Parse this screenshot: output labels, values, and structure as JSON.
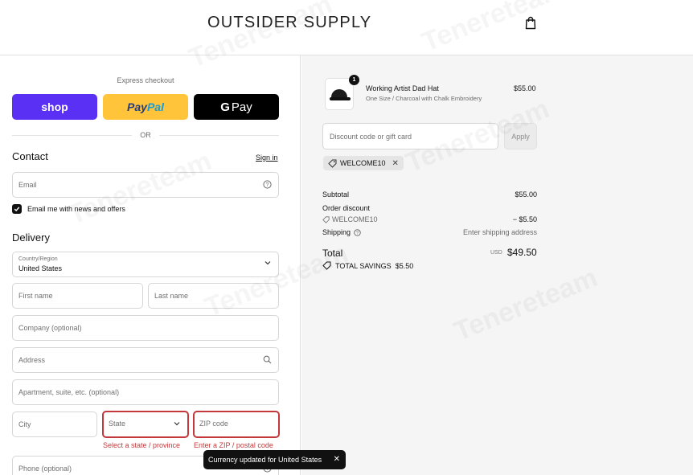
{
  "header": {
    "brand": "OUTSIDER SUPPLY",
    "cart_icon": "shopping-bag-icon"
  },
  "express": {
    "title": "Express checkout",
    "shop_label": "shop",
    "paypal_label_1": "Pay",
    "paypal_label_2": "Pal",
    "gpay_g": "G",
    "gpay_label": "Pay",
    "or_label": "OR"
  },
  "contact": {
    "heading": "Contact",
    "sign_in": "Sign in",
    "email_placeholder": "Email",
    "newsletter_label": "Email me with news and offers",
    "newsletter_checked": true
  },
  "delivery": {
    "heading": "Delivery",
    "country_label": "Country/Region",
    "country_value": "United States",
    "first_name": "First name",
    "last_name": "Last name",
    "company": "Company (optional)",
    "address": "Address",
    "apartment": "Apartment, suite, etc. (optional)",
    "city": "City",
    "state": "State",
    "zip": "ZIP code",
    "state_error": "Select a state / province",
    "zip_error": "Enter a ZIP / postal code",
    "phone": "Phone (optional)"
  },
  "order": {
    "item": {
      "quantity": "1",
      "name": "Working Artist Dad Hat",
      "variant": "One Size / Charcoal with Chalk Embroidery",
      "price": "$55.00"
    },
    "discount_placeholder": "Discount code or gift card",
    "apply_label": "Apply",
    "applied_code": "WELCOME10",
    "subtotal_label": "Subtotal",
    "subtotal_value": "$55.00",
    "order_discount_label": "Order discount",
    "discount_code": "WELCOME10",
    "discount_value": "− $5.50",
    "shipping_label": "Shipping",
    "shipping_value": "Enter shipping address",
    "total_label": "Total",
    "total_currency": "USD",
    "total_value": "$49.50",
    "savings_label": "TOTAL SAVINGS",
    "savings_value": "$5.50"
  },
  "toast": {
    "message": "Currency updated for United States"
  },
  "watermark": "Tenereteam",
  "colors": {
    "shop_purple": "#5a31f4",
    "paypal_yellow": "#ffc439",
    "error_red": "#c3383b"
  }
}
